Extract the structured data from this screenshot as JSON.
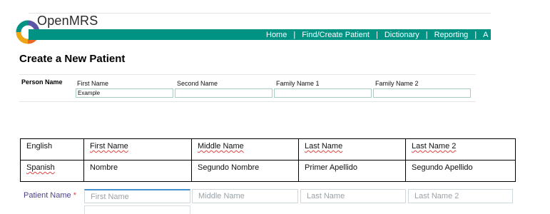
{
  "header": {
    "brand": "OpenMRS",
    "nav": [
      "Home",
      "Find/Create Patient",
      "Dictionary",
      "Reporting",
      "A"
    ],
    "separator": "|",
    "accent_color": "#009384",
    "logo_icon": "openmrs-logo-icon"
  },
  "form": {
    "title": "Create a New Patient",
    "person_name_label": "Person Name",
    "fields": [
      {
        "label": "First Name",
        "value": "Example"
      },
      {
        "label": "Second Name",
        "value": ""
      },
      {
        "label": "Family Name 1",
        "value": ""
      },
      {
        "label": "Family Name 2",
        "value": ""
      }
    ]
  },
  "translations": {
    "rows": [
      [
        "English",
        "First Name",
        "Middle Name",
        "Last Name",
        "Last Name 2"
      ],
      [
        "Spanish",
        "Nombre",
        "Segundo Nombre",
        "Primer Apellido",
        "Segundo Apellido"
      ]
    ]
  },
  "patient_name": {
    "label": "Patient Name",
    "required_mark": "*",
    "placeholders": [
      "First Name",
      "Middle Name",
      "Last Name",
      "Last Name 2"
    ]
  }
}
